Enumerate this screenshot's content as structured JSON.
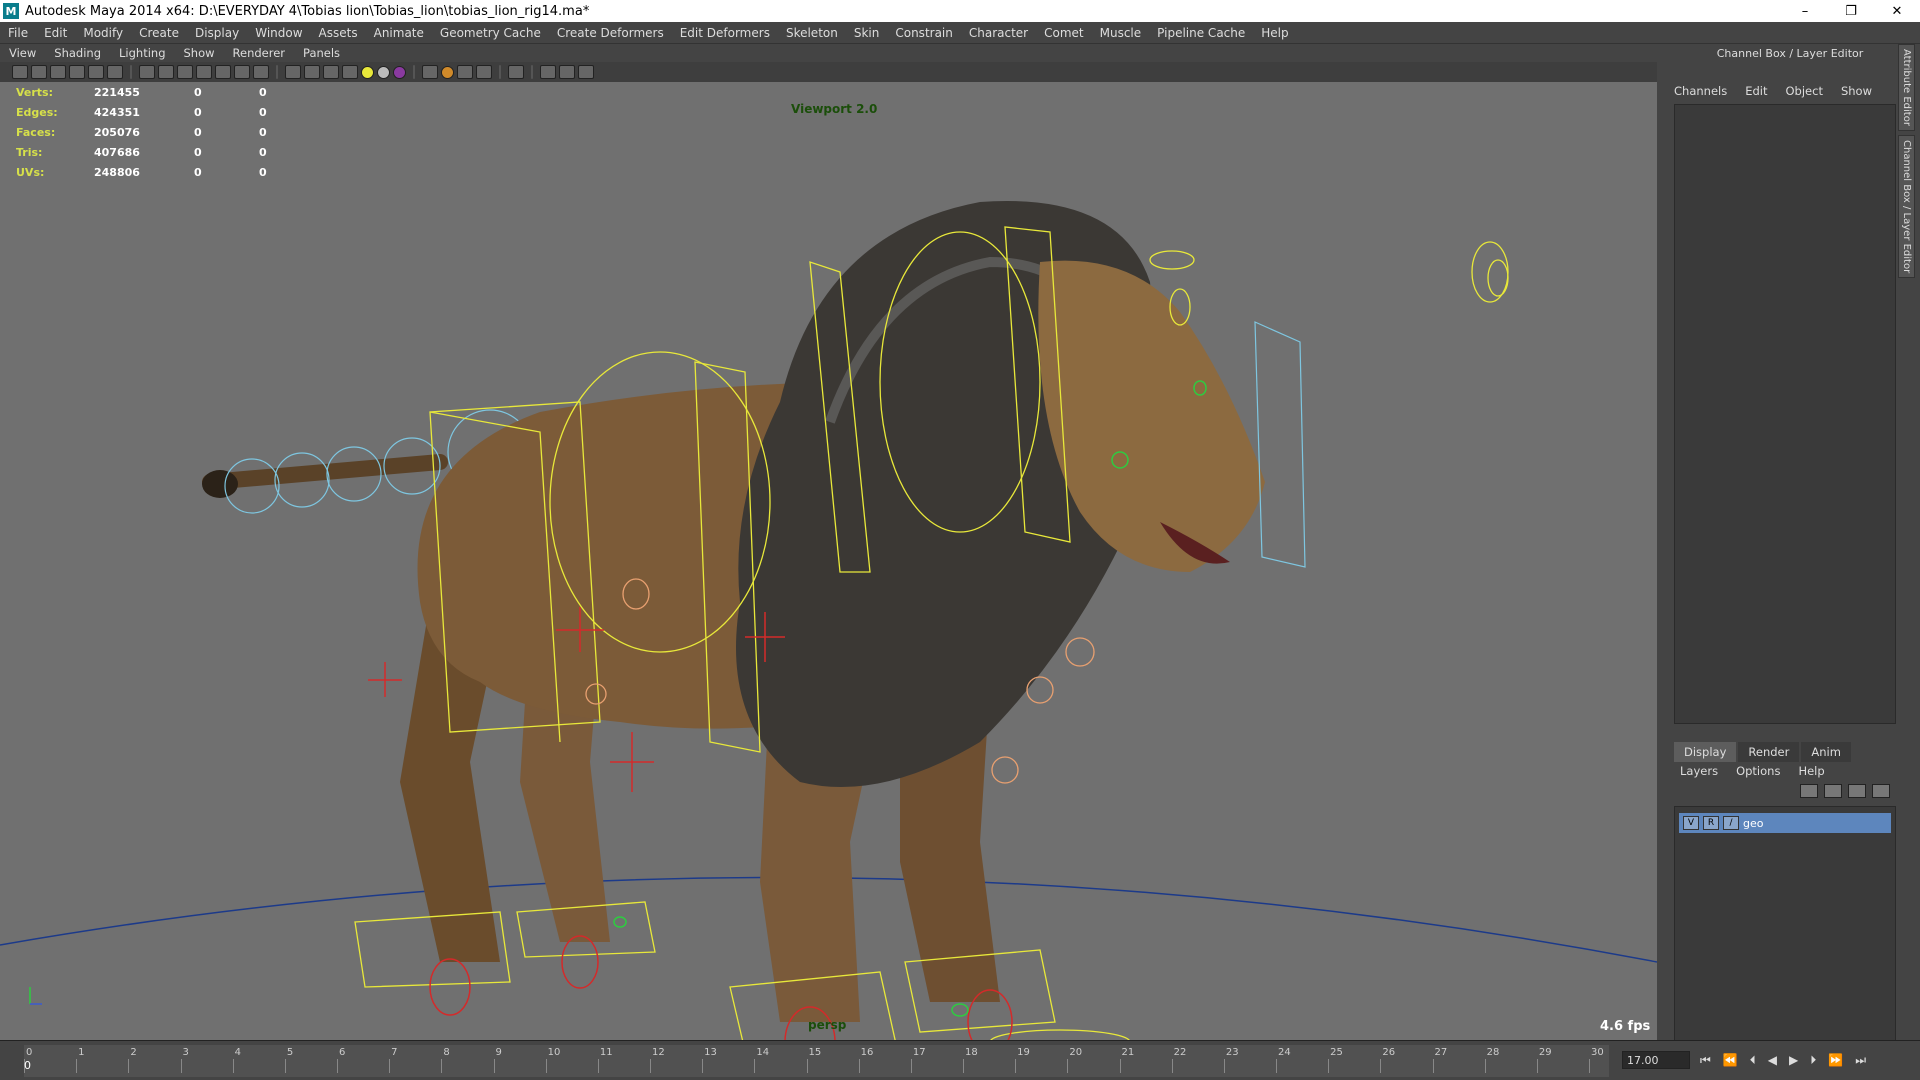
{
  "window": {
    "title": "Autodesk Maya 2014 x64: D:\\EVERYDAY 4\\Tobias lion\\Tobias_lion\\tobias_lion_rig14.ma*"
  },
  "menu": [
    "File",
    "Edit",
    "Modify",
    "Create",
    "Display",
    "Window",
    "Assets",
    "Animate",
    "Geometry Cache",
    "Create Deformers",
    "Edit Deformers",
    "Skeleton",
    "Skin",
    "Constrain",
    "Character",
    "Comet",
    "Muscle",
    "Pipeline Cache",
    "Help"
  ],
  "viewport_menu": [
    "View",
    "Shading",
    "Lighting",
    "Show",
    "Renderer",
    "Panels"
  ],
  "hud": {
    "rows": [
      {
        "label": "Verts:",
        "a": "221455",
        "b": "0",
        "c": "0"
      },
      {
        "label": "Edges:",
        "a": "424351",
        "b": "0",
        "c": "0"
      },
      {
        "label": "Faces:",
        "a": "205076",
        "b": "0",
        "c": "0"
      },
      {
        "label": "Tris:",
        "a": "407686",
        "b": "0",
        "c": "0"
      },
      {
        "label": "UVs:",
        "a": "248806",
        "b": "0",
        "c": "0"
      }
    ],
    "renderer": "Viewport 2.0",
    "camera": "persp",
    "fps": "4.6 fps"
  },
  "channel_box": {
    "title": "Channel Box / Layer Editor",
    "menu": [
      "Channels",
      "Edit",
      "Object",
      "Show"
    ],
    "side_tabs": [
      "Attribute Editor",
      "Channel Box / Layer Editor"
    ]
  },
  "layer_editor": {
    "tabs": [
      "Display",
      "Render",
      "Anim"
    ],
    "menu": [
      "Layers",
      "Options",
      "Help"
    ],
    "layer": {
      "v": "V",
      "r": "R",
      "name": "geo"
    }
  },
  "timeline": {
    "frames": [
      "0",
      "1",
      "2",
      "3",
      "4",
      "5",
      "6",
      "7",
      "8",
      "9",
      "10",
      "11",
      "12",
      "13",
      "14",
      "15",
      "16",
      "17",
      "18",
      "19",
      "20",
      "21",
      "22",
      "23",
      "24",
      "25",
      "26",
      "27",
      "28",
      "29",
      "30"
    ],
    "current": "0",
    "field": "17.00"
  },
  "colors": {
    "viewport_bg": "#707070",
    "rig_yellow": "#e8e83a",
    "hud_label": "#d6e04a",
    "layer_sel": "#5d86bd"
  }
}
